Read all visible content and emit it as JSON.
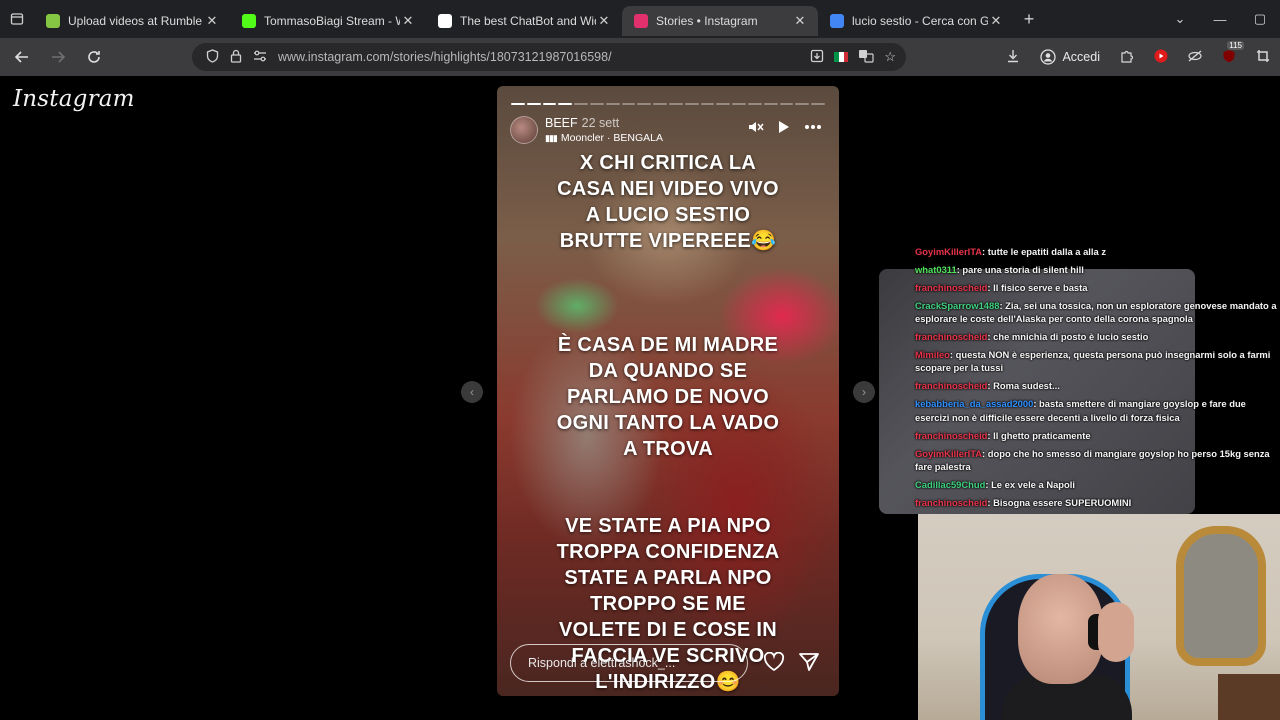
{
  "browser": {
    "tabs": [
      {
        "title": "Upload videos at Rumble",
        "favicon": "rumble-icon",
        "color": "#85c742",
        "active": false
      },
      {
        "title": "TommasoBiagi Stream - Watch Live",
        "favicon": "kick-icon",
        "color": "#53fc18",
        "active": false
      },
      {
        "title": "The best ChatBot and Widgets",
        "favicon": "diamond-icon",
        "color": "#ffffff",
        "active": false
      },
      {
        "title": "Stories • Instagram",
        "favicon": "instagram-icon",
        "color": "#e1306c",
        "active": true
      },
      {
        "title": "lucio sestio - Cerca con Google",
        "favicon": "google-icon",
        "color": "#4285f4",
        "active": false
      }
    ],
    "url": "www.instagram.com/stories/highlights/18073121987016598/",
    "accedi_label": "Accedi",
    "extension_badge": "115"
  },
  "instagram": {
    "logo_text": "Instagram",
    "story": {
      "username": "BEEF",
      "time": "22 sett",
      "music": "Mooncler · BENGALA",
      "progress_segments": 20,
      "progress_done": 4,
      "text_block_1": "X CHI CRITICA LA\nCASA NEI VIDEO VIVO\nA LUCIO SESTIO\nBRUTTE VIPEREEE😂",
      "text_block_2": "È CASA DE MI MADRE\nDA QUANDO SE\nPARLAMO DE NOVO\nOGNI TANTO LA VADO\nA TROVA",
      "text_block_3": "VE STATE A PIA NPO\nTROPPA CONFIDENZA\nSTATE A PARLA NPO\nTROPPO SE ME\nVOLETE DI E COSE IN\nFACCIA VE SCRIVO\nL'INDIRIZZO😊",
      "reply_placeholder": "Rispondi a elettrashock_..."
    }
  },
  "chat": [
    {
      "user": "GoyimKillerITA",
      "color": "#e8334a",
      "text": ": tutte le epatiti dalla a alla z"
    },
    {
      "user": "what0311",
      "color": "#4fe35a",
      "text": ": pare una storia di silent hill"
    },
    {
      "user": "franchinoscheid",
      "color": "#e8334a",
      "text": ": Il fisico serve e basta"
    },
    {
      "user": "CrackSparrow1488",
      "color": "#3fd17f",
      "text": ": Zia, sei una tossica, non un esploratore genovese mandato a esplorare le coste dell'Alaska per conto della corona spagnola"
    },
    {
      "user": "franchinoscheid",
      "color": "#e8334a",
      "text": ": che mnichia di posto è lucio sestio"
    },
    {
      "user": "Mimileo",
      "color": "#e8334a",
      "text": ": questa NON è esperienza, questa persona può insegnarmi solo a farmi scopare per la tussi"
    },
    {
      "user": "franchinoscheid",
      "color": "#e8334a",
      "text": ": Roma sudest..."
    },
    {
      "user": "kebabberia_da_assad2000",
      "color": "#2f8fff",
      "text": ": basta smettere di mangiare goyslop e fare due esercizi non è difficile essere decenti a livello di forza fisica"
    },
    {
      "user": "franchinoscheid",
      "color": "#e8334a",
      "text": ": Il ghetto praticamente"
    },
    {
      "user": "GoyimKillerITA",
      "color": "#e8334a",
      "text": ": dopo che ho smesso di mangiare goyslop ho perso 15kg senza fare palestra"
    },
    {
      "user": "Cadillac59Chud",
      "color": "#3fd17f",
      "text": ": Le ex vele a Napoli"
    },
    {
      "user": "franchinoscheid",
      "color": "#e8334a",
      "text": ": Bisogna essere SUPERUOMINI"
    }
  ]
}
